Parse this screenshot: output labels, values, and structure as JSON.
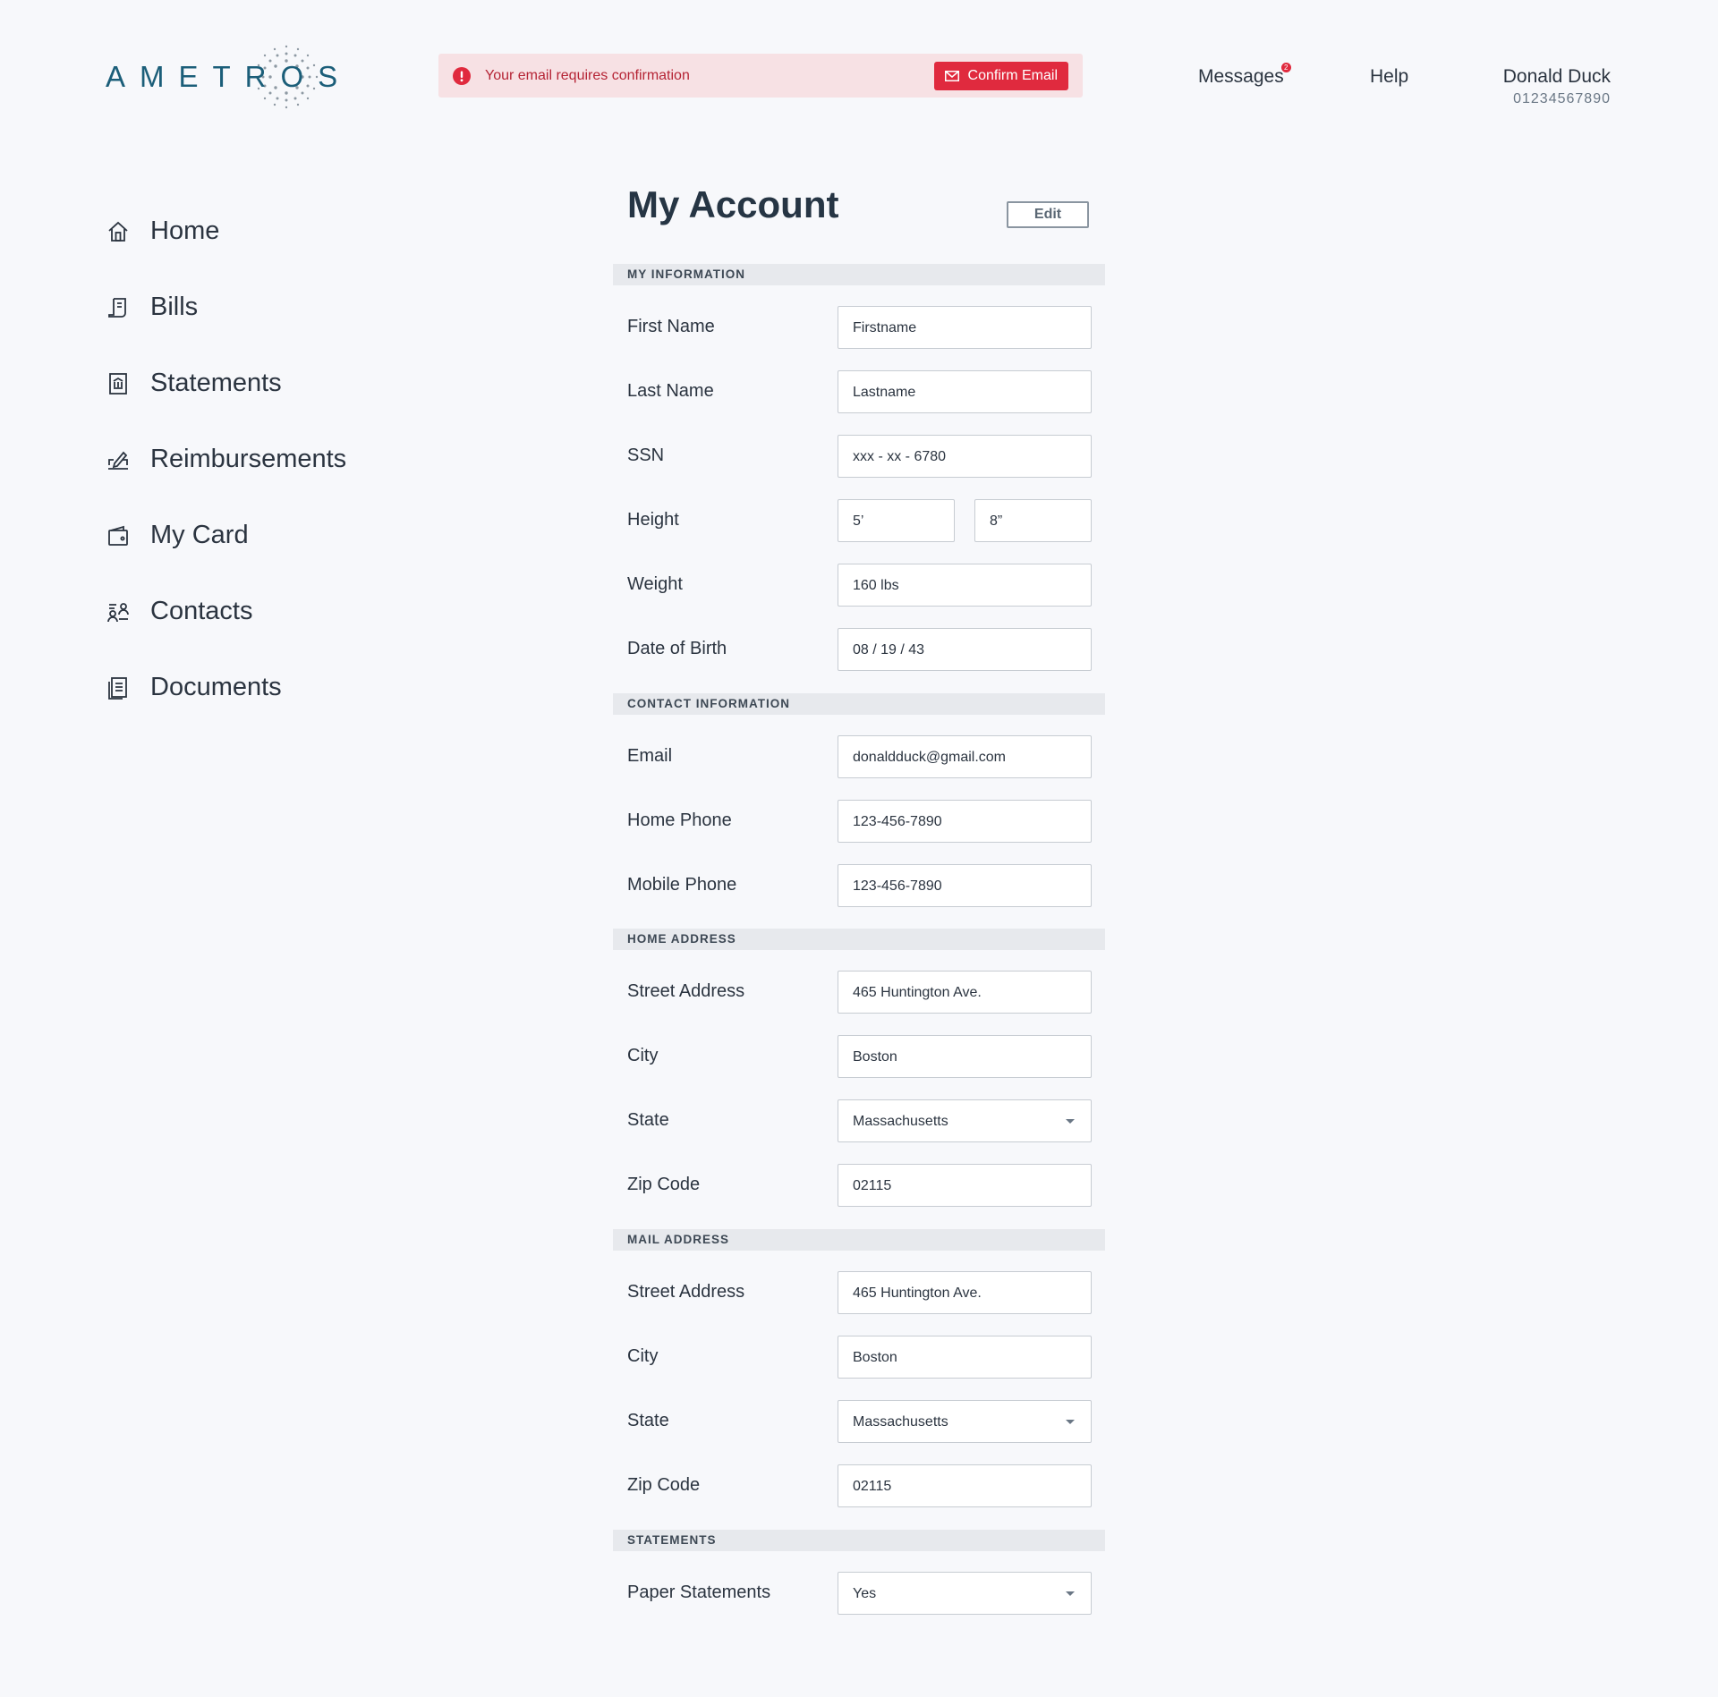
{
  "header": {
    "logo_text": "AMETROS",
    "alert": {
      "message": "Your email requires confirmation",
      "button_label": "Confirm Email"
    },
    "nav": {
      "messages": "Messages",
      "messages_badge": "2",
      "help": "Help"
    },
    "user": {
      "name": "Donald Duck",
      "id": "01234567890"
    }
  },
  "sidebar": {
    "items": [
      {
        "label": "Home",
        "icon": "home-icon"
      },
      {
        "label": "Bills",
        "icon": "bill-icon"
      },
      {
        "label": "Statements",
        "icon": "statement-icon"
      },
      {
        "label": "Reimbursements",
        "icon": "reimbursement-icon"
      },
      {
        "label": "My Card",
        "icon": "card-icon"
      },
      {
        "label": "Contacts",
        "icon": "contacts-icon"
      },
      {
        "label": "Documents",
        "icon": "documents-icon"
      }
    ]
  },
  "main": {
    "title": "My Account",
    "edit_label": "Edit",
    "sections": {
      "my_information": {
        "title": "MY INFORMATION",
        "first_name": {
          "label": "First Name",
          "value": "Firstname"
        },
        "last_name": {
          "label": "Last Name",
          "value": "Lastname"
        },
        "ssn": {
          "label": "SSN",
          "value": "xxx - xx - 6780"
        },
        "height": {
          "label": "Height",
          "feet": "5’",
          "inches": "8”"
        },
        "weight": {
          "label": "Weight",
          "value": "160 lbs"
        },
        "dob": {
          "label": "Date of Birth",
          "value": "08 / 19 / 43"
        }
      },
      "contact_information": {
        "title": "CONTACT INFORMATION",
        "email": {
          "label": "Email",
          "value": "donaldduck@gmail.com"
        },
        "home_phone": {
          "label": "Home Phone",
          "value": "123-456-7890"
        },
        "mobile_phone": {
          "label": "Mobile Phone",
          "value": "123-456-7890"
        }
      },
      "home_address": {
        "title": "HOME ADDRESS",
        "street": {
          "label": "Street Address",
          "value": "465 Huntington Ave."
        },
        "city": {
          "label": "City",
          "value": "Boston"
        },
        "state": {
          "label": "State",
          "value": "Massachusetts"
        },
        "zip": {
          "label": "Zip Code",
          "value": "02115"
        }
      },
      "mail_address": {
        "title": "MAIL ADDRESS",
        "street": {
          "label": "Street Address",
          "value": "465 Huntington Ave."
        },
        "city": {
          "label": "City",
          "value": "Boston"
        },
        "state": {
          "label": "State",
          "value": "Massachusetts"
        },
        "zip": {
          "label": "Zip Code",
          "value": "02115"
        }
      },
      "statements": {
        "title": "STATEMENTS",
        "paper": {
          "label": "Paper Statements",
          "value": "Yes"
        }
      }
    }
  },
  "colors": {
    "brand": "#1b5e79",
    "alert_bg": "#f7e1e4",
    "alert_accent": "#e02a3e",
    "text": "#2b3440"
  }
}
